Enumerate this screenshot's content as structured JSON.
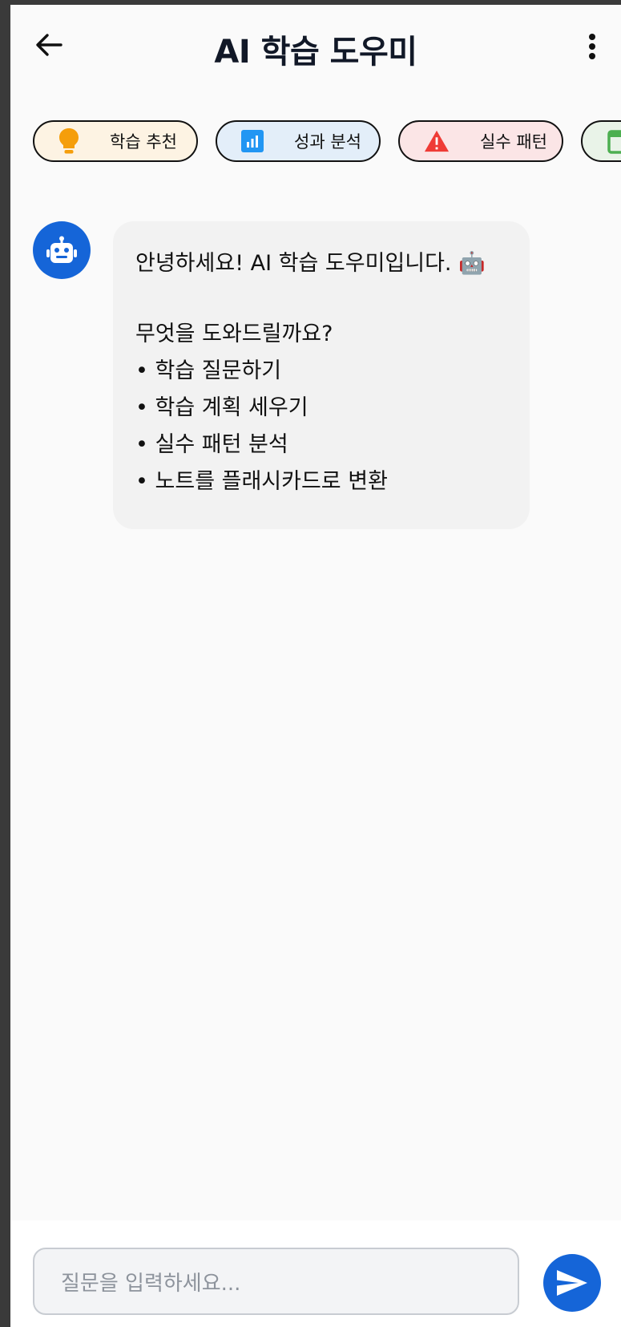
{
  "header": {
    "title": "AI 학습 도우미",
    "back_icon": "arrow-back-icon",
    "menu_icon": "more-vert-icon"
  },
  "chips": [
    {
      "label": "학습 추천",
      "icon": "lightbulb-icon",
      "color": "#f59e0b"
    },
    {
      "label": "성과 분석",
      "icon": "bar-chart-icon",
      "color": "#2196f3"
    },
    {
      "label": "실수 패턴",
      "icon": "warning-icon",
      "color": "#ef3b36"
    },
    {
      "label": "",
      "icon": "calendar-icon",
      "color": "#4caf50"
    }
  ],
  "chat": {
    "bot_avatar_icon": "robot-icon",
    "message": {
      "greeting": "안녕하세요! AI 학습 도우미입니다. 🤖",
      "question": "무엇을 도와드릴까요?",
      "items": [
        "• 학습 질문하기",
        "• 학습 계획 세우기",
        "• 실수 패턴 분석",
        "• 노트를 플래시카드로 변환"
      ]
    }
  },
  "input": {
    "placeholder": "질문을 입력하세요...",
    "send_icon": "send-icon"
  },
  "colors": {
    "primary": "#1565d8",
    "background": "#fafafa"
  }
}
